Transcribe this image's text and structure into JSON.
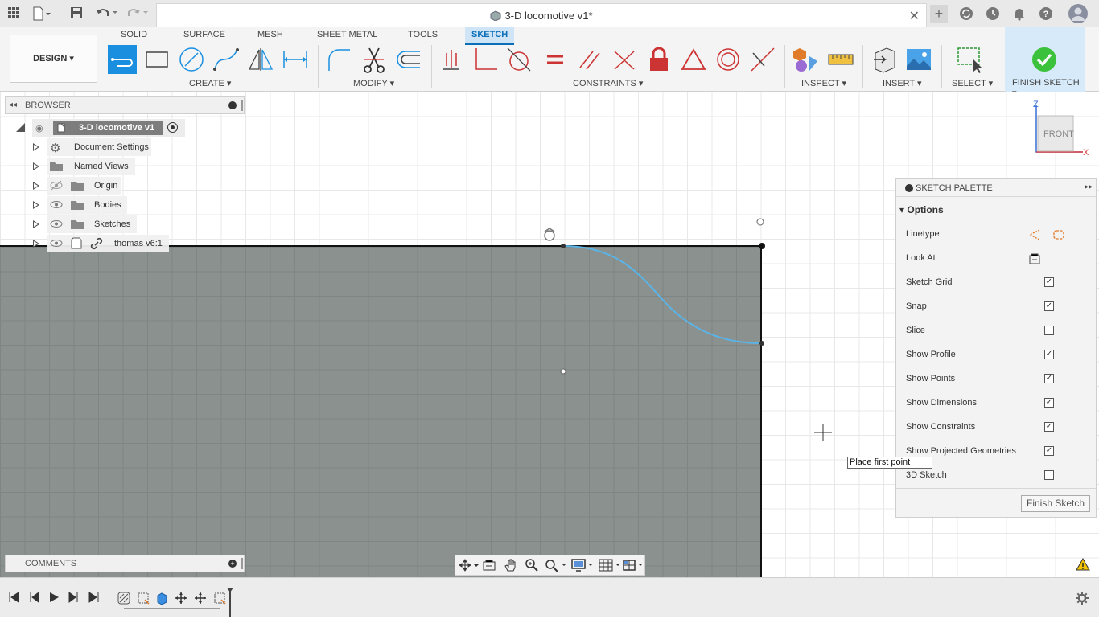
{
  "titlebar": {
    "doc_title": "3-D locomotive v1*"
  },
  "ribbon": {
    "workspace_label": "DESIGN",
    "tabs": [
      "SOLID",
      "SURFACE",
      "MESH",
      "SHEET METAL",
      "TOOLS",
      "SKETCH"
    ],
    "groups": {
      "create": "CREATE",
      "modify": "MODIFY",
      "constraints": "CONSTRAINTS",
      "inspect": "INSPECT",
      "insert": "INSERT",
      "select": "SELECT",
      "finish": "FINISH SKETCH"
    }
  },
  "browser": {
    "header": "BROWSER",
    "items": [
      {
        "label": "3-D locomotive v1"
      },
      {
        "label": "Document Settings"
      },
      {
        "label": "Named Views"
      },
      {
        "label": "Origin"
      },
      {
        "label": "Bodies"
      },
      {
        "label": "Sketches"
      },
      {
        "label": "thomas v6:1"
      }
    ]
  },
  "viewcube": {
    "face_label": "FRONT",
    "axis_z": "Z",
    "axis_x": "X"
  },
  "palette": {
    "title": "SKETCH PALETTE",
    "section": "Options",
    "rows": [
      {
        "label": "Linetype",
        "type": "icons"
      },
      {
        "label": "Look At",
        "type": "icon"
      },
      {
        "label": "Sketch Grid",
        "checked": true
      },
      {
        "label": "Snap",
        "checked": true
      },
      {
        "label": "Slice",
        "checked": false
      },
      {
        "label": "Show Profile",
        "checked": true
      },
      {
        "label": "Show Points",
        "checked": true
      },
      {
        "label": "Show Dimensions",
        "checked": true
      },
      {
        "label": "Show Constraints",
        "checked": true
      },
      {
        "label": "Show Projected Geometries",
        "checked": true
      },
      {
        "label": "3D Sketch",
        "checked": false
      }
    ],
    "finish_button": "Finish Sketch"
  },
  "tooltip": "Place first point",
  "comments": {
    "header": "COMMENTS"
  }
}
